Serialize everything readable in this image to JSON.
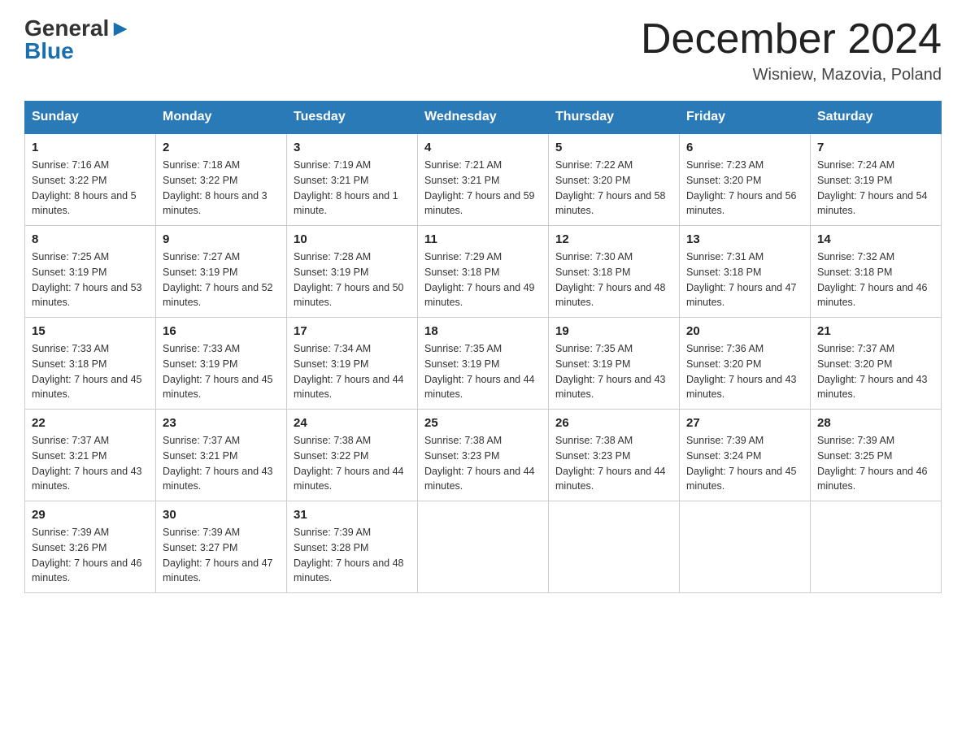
{
  "logo": {
    "line1_black": "General",
    "line1_blue": "Blue",
    "line2": "Blue"
  },
  "title": {
    "month_year": "December 2024",
    "location": "Wisniew, Mazovia, Poland"
  },
  "days_of_week": [
    "Sunday",
    "Monday",
    "Tuesday",
    "Wednesday",
    "Thursday",
    "Friday",
    "Saturday"
  ],
  "weeks": [
    [
      {
        "day": "1",
        "sunrise": "7:16 AM",
        "sunset": "3:22 PM",
        "daylight": "8 hours and 5 minutes."
      },
      {
        "day": "2",
        "sunrise": "7:18 AM",
        "sunset": "3:22 PM",
        "daylight": "8 hours and 3 minutes."
      },
      {
        "day": "3",
        "sunrise": "7:19 AM",
        "sunset": "3:21 PM",
        "daylight": "8 hours and 1 minute."
      },
      {
        "day": "4",
        "sunrise": "7:21 AM",
        "sunset": "3:21 PM",
        "daylight": "7 hours and 59 minutes."
      },
      {
        "day": "5",
        "sunrise": "7:22 AM",
        "sunset": "3:20 PM",
        "daylight": "7 hours and 58 minutes."
      },
      {
        "day": "6",
        "sunrise": "7:23 AM",
        "sunset": "3:20 PM",
        "daylight": "7 hours and 56 minutes."
      },
      {
        "day": "7",
        "sunrise": "7:24 AM",
        "sunset": "3:19 PM",
        "daylight": "7 hours and 54 minutes."
      }
    ],
    [
      {
        "day": "8",
        "sunrise": "7:25 AM",
        "sunset": "3:19 PM",
        "daylight": "7 hours and 53 minutes."
      },
      {
        "day": "9",
        "sunrise": "7:27 AM",
        "sunset": "3:19 PM",
        "daylight": "7 hours and 52 minutes."
      },
      {
        "day": "10",
        "sunrise": "7:28 AM",
        "sunset": "3:19 PM",
        "daylight": "7 hours and 50 minutes."
      },
      {
        "day": "11",
        "sunrise": "7:29 AM",
        "sunset": "3:18 PM",
        "daylight": "7 hours and 49 minutes."
      },
      {
        "day": "12",
        "sunrise": "7:30 AM",
        "sunset": "3:18 PM",
        "daylight": "7 hours and 48 minutes."
      },
      {
        "day": "13",
        "sunrise": "7:31 AM",
        "sunset": "3:18 PM",
        "daylight": "7 hours and 47 minutes."
      },
      {
        "day": "14",
        "sunrise": "7:32 AM",
        "sunset": "3:18 PM",
        "daylight": "7 hours and 46 minutes."
      }
    ],
    [
      {
        "day": "15",
        "sunrise": "7:33 AM",
        "sunset": "3:18 PM",
        "daylight": "7 hours and 45 minutes."
      },
      {
        "day": "16",
        "sunrise": "7:33 AM",
        "sunset": "3:19 PM",
        "daylight": "7 hours and 45 minutes."
      },
      {
        "day": "17",
        "sunrise": "7:34 AM",
        "sunset": "3:19 PM",
        "daylight": "7 hours and 44 minutes."
      },
      {
        "day": "18",
        "sunrise": "7:35 AM",
        "sunset": "3:19 PM",
        "daylight": "7 hours and 44 minutes."
      },
      {
        "day": "19",
        "sunrise": "7:35 AM",
        "sunset": "3:19 PM",
        "daylight": "7 hours and 43 minutes."
      },
      {
        "day": "20",
        "sunrise": "7:36 AM",
        "sunset": "3:20 PM",
        "daylight": "7 hours and 43 minutes."
      },
      {
        "day": "21",
        "sunrise": "7:37 AM",
        "sunset": "3:20 PM",
        "daylight": "7 hours and 43 minutes."
      }
    ],
    [
      {
        "day": "22",
        "sunrise": "7:37 AM",
        "sunset": "3:21 PM",
        "daylight": "7 hours and 43 minutes."
      },
      {
        "day": "23",
        "sunrise": "7:37 AM",
        "sunset": "3:21 PM",
        "daylight": "7 hours and 43 minutes."
      },
      {
        "day": "24",
        "sunrise": "7:38 AM",
        "sunset": "3:22 PM",
        "daylight": "7 hours and 44 minutes."
      },
      {
        "day": "25",
        "sunrise": "7:38 AM",
        "sunset": "3:23 PM",
        "daylight": "7 hours and 44 minutes."
      },
      {
        "day": "26",
        "sunrise": "7:38 AM",
        "sunset": "3:23 PM",
        "daylight": "7 hours and 44 minutes."
      },
      {
        "day": "27",
        "sunrise": "7:39 AM",
        "sunset": "3:24 PM",
        "daylight": "7 hours and 45 minutes."
      },
      {
        "day": "28",
        "sunrise": "7:39 AM",
        "sunset": "3:25 PM",
        "daylight": "7 hours and 46 minutes."
      }
    ],
    [
      {
        "day": "29",
        "sunrise": "7:39 AM",
        "sunset": "3:26 PM",
        "daylight": "7 hours and 46 minutes."
      },
      {
        "day": "30",
        "sunrise": "7:39 AM",
        "sunset": "3:27 PM",
        "daylight": "7 hours and 47 minutes."
      },
      {
        "day": "31",
        "sunrise": "7:39 AM",
        "sunset": "3:28 PM",
        "daylight": "7 hours and 48 minutes."
      },
      null,
      null,
      null,
      null
    ]
  ]
}
